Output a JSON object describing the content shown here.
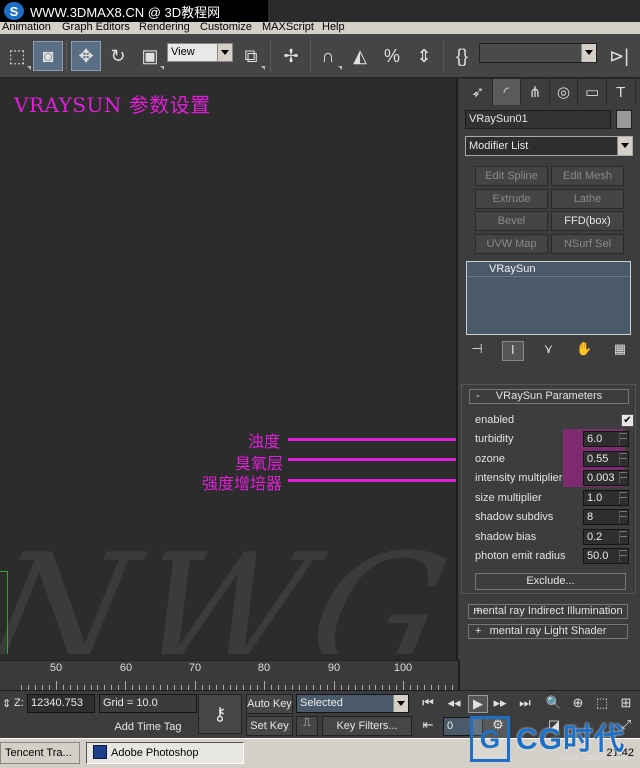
{
  "watermark": {
    "logo": "S",
    "text": "WWW.3DMAX8.CN @ 3D教程网"
  },
  "menu": [
    "Animation",
    "Graph Editors",
    "Rendering",
    "Customize",
    "MAXScript",
    "Help"
  ],
  "toolbar": {
    "view_select": "View"
  },
  "viewport": {
    "title": "VRAYSUN 参数设置",
    "watermark_text": "NWG",
    "annotations": [
      "浊度",
      "臭氧层",
      "强度增培器"
    ]
  },
  "panel": {
    "object_name": "VRaySun01",
    "modifier_list": "Modifier List",
    "modifier_buttons": [
      "Edit Spline",
      "Edit Mesh",
      "Extrude",
      "Lathe",
      "Bevel",
      "FFD(box)",
      "UVW Map",
      "NSurf Sel"
    ],
    "stack_item": "VRaySun",
    "rollout": {
      "title": "VRaySun Parameters",
      "collapse": "-",
      "enabled_label": "enabled",
      "enabled_checked": true,
      "params": [
        {
          "label": "turbidity",
          "value": "6.0"
        },
        {
          "label": "ozone",
          "value": "0.55"
        },
        {
          "label": "intensity multiplier",
          "value": "0.003"
        },
        {
          "label": "size multiplier",
          "value": "1.0"
        },
        {
          "label": "shadow subdivs",
          "value": "8"
        },
        {
          "label": "shadow bias",
          "value": "0.2"
        },
        {
          "label": "photon emit radius",
          "value": "50.0"
        }
      ],
      "exclude": "Exclude..."
    },
    "rollout2": {
      "prefix": "+",
      "title": "mental ray Indirect Illumination"
    },
    "rollout3": {
      "prefix": "+",
      "title": "mental ray Light Shader"
    }
  },
  "trackbar": {
    "ticks": [
      "50",
      "60",
      "70",
      "80",
      "90",
      "100"
    ]
  },
  "status": {
    "z_label": "Z:",
    "z_value": "12340.753",
    "grid": "Grid = 10.0",
    "add_time_tag": "Add Time Tag",
    "auto_key": "Auto Key",
    "set_key": "Set Key",
    "selected": "Selected",
    "key_filters": "Key Filters...",
    "frame": "0"
  },
  "taskbar": {
    "items": [
      "Tencent Tra...",
      "Adobe Photoshop"
    ],
    "clock": "21:42"
  },
  "site_watermark": {
    "box": "G",
    "big": "CG时代",
    "small": "www.cgtime.com"
  },
  "colors": {
    "annotation": "#e020d8",
    "highlight": "#8a2878",
    "panel": "#3d3d3d"
  }
}
